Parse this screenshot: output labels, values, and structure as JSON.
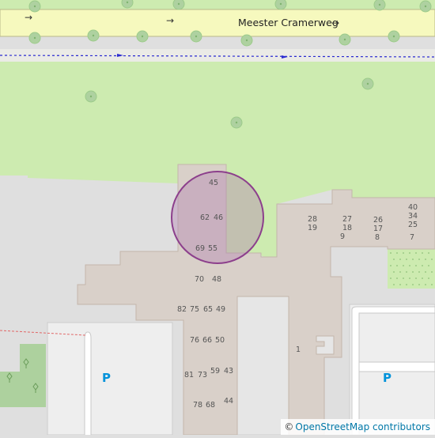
{
  "street": {
    "name": "Meester Cramerweg",
    "arrow_glyph": "→"
  },
  "house_numbers": {
    "n45": "45",
    "n62": "62",
    "n46": "46",
    "n69": "69",
    "n55": "55",
    "n70": "70",
    "n48": "48",
    "n82": "82",
    "n75": "75",
    "n65": "65",
    "n49": "49",
    "n76": "76",
    "n66": "66",
    "n50": "50",
    "n81": "81",
    "n73": "73",
    "n59": "59",
    "n43": "43",
    "n78": "78",
    "n68": "68",
    "n44": "44",
    "n1": "1",
    "n28": "28",
    "n19": "19",
    "n27": "27",
    "n18": "18",
    "n9": "9",
    "n26": "26",
    "n17": "17",
    "n8": "8",
    "n40": "40",
    "n34": "34",
    "n25": "25",
    "n7": "7"
  },
  "parking": {
    "left_label": "P",
    "right_label": "P"
  },
  "attribution": {
    "copyright": "©",
    "text": "OpenStreetMap contributors"
  },
  "colors": {
    "grass": "#cdebb0",
    "road": "#f6f9be",
    "building": "#d9d0c9",
    "highlight_stroke": "#8c3f8c",
    "highlight_fill": "#b27fb2",
    "parking_blue": "#0092da",
    "tree": "#aed1a0"
  }
}
